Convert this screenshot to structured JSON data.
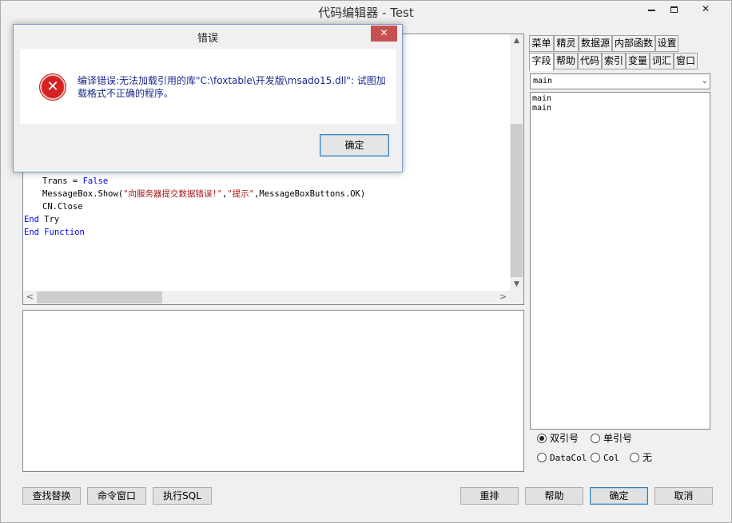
{
  "window": {
    "title": "代码编辑器 - Test",
    "min_symbol": "",
    "max_symbol": "",
    "close_symbol": "✕"
  },
  "editor": {
    "lines": [
      {
        "indent": "    ",
        "parts": [
          {
            "t": "Trans = ",
            "c": "plain"
          },
          {
            "t": "False",
            "c": "kw"
          }
        ]
      },
      {
        "indent": "    ",
        "parts": [
          {
            "t": "MessageBox.Show(",
            "c": "plain"
          },
          {
            "t": "\"向服务器提交数据错误!\"",
            "c": "str"
          },
          {
            "t": ",",
            "c": "plain"
          },
          {
            "t": "\"提示\"",
            "c": "str"
          },
          {
            "t": ",MessageBoxButtons.OK)",
            "c": "plain"
          }
        ]
      },
      {
        "indent": "    ",
        "parts": [
          {
            "t": "CN.Close",
            "c": "plain"
          }
        ]
      },
      {
        "indent": "",
        "parts": [
          {
            "t": "End",
            "c": "kw"
          },
          {
            "t": " Try",
            "c": "plain"
          }
        ]
      },
      {
        "indent": "",
        "parts": [
          {
            "t": "End",
            "c": "kw"
          },
          {
            "t": " ",
            "c": "plain"
          },
          {
            "t": "Function",
            "c": "kw"
          }
        ]
      }
    ],
    "scroll_up": "▲",
    "scroll_down": "▼",
    "scroll_left": "<",
    "scroll_right": ">"
  },
  "right_panel": {
    "tabs_row1": [
      "菜单",
      "精灵",
      "数据源",
      "内部函数",
      "设置"
    ],
    "tabs_row2": [
      "字段",
      "帮助",
      "代码",
      "索引",
      "变量",
      "词汇",
      "窗口"
    ],
    "active_tab": "字段",
    "select_value": "main",
    "list_items": [
      "main",
      "main"
    ],
    "quote_options": [
      {
        "label": "双引号",
        "checked": true
      },
      {
        "label": "单引号",
        "checked": false
      }
    ],
    "col_options": [
      {
        "label": "DataCol",
        "checked": false
      },
      {
        "label": "Col",
        "checked": false
      },
      {
        "label": "无",
        "checked": false
      }
    ]
  },
  "buttons": {
    "find_replace": "查找替换",
    "command_window": "命令窗口",
    "execute_sql": "执行SQL",
    "rearrange": "重排",
    "help": "帮助",
    "ok": "确定",
    "cancel": "取消"
  },
  "dialog": {
    "title": "错误",
    "close_symbol": "✕",
    "icon_symbol": "✕",
    "message": "编译错误:无法加载引用的库\"C:\\foxtable\\开发版\\msado15.dll\": 试图加载格式不正确的程序。",
    "ok_label": "确定"
  },
  "colors": {
    "keyword": "#0000ff",
    "string": "#a31515",
    "error_red": "#d52323",
    "dialog_text": "#1a2a8a"
  }
}
